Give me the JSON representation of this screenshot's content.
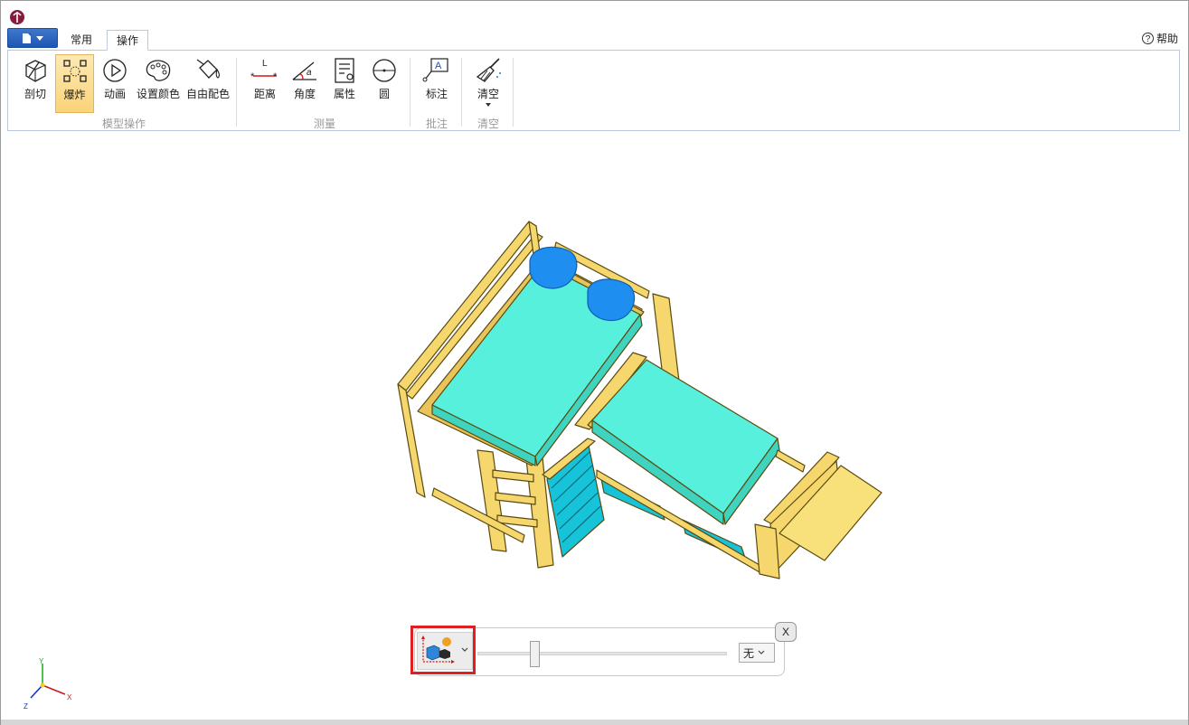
{
  "window": {
    "title": ""
  },
  "ribbon": {
    "tabs": [
      {
        "label": "常用",
        "active": false
      },
      {
        "label": "操作",
        "active": true
      }
    ],
    "help_label": "帮助",
    "groups": {
      "model_ops": {
        "label": "模型操作",
        "tools": {
          "section": "剖切",
          "explode": "爆炸",
          "animate": "动画",
          "set_color": "设置颜色",
          "free_color": "自由配色"
        }
      },
      "measure": {
        "label": "测量",
        "tools": {
          "distance": "距离",
          "angle": "角度",
          "property": "属性",
          "circle": "圆"
        }
      },
      "annotate": {
        "label": "批注",
        "tools": {
          "markup": "标注"
        }
      },
      "clear": {
        "label": "清空",
        "tools": {
          "clear": "清空"
        }
      }
    }
  },
  "explode_panel": {
    "slider_level_percent": 22,
    "axis_select_value": "无",
    "close_label": "X"
  },
  "axis_triad": {
    "x": "X",
    "y": "Y",
    "z": "Z"
  },
  "colors": {
    "wood": "#f5d76e",
    "wood_edge": "#5a4a10",
    "mattress": "#57f0dc",
    "pillow": "#1e8ef0",
    "drawer": "#17c3d8",
    "active_tool": "#fbd37a",
    "highlight": "#e02020"
  }
}
